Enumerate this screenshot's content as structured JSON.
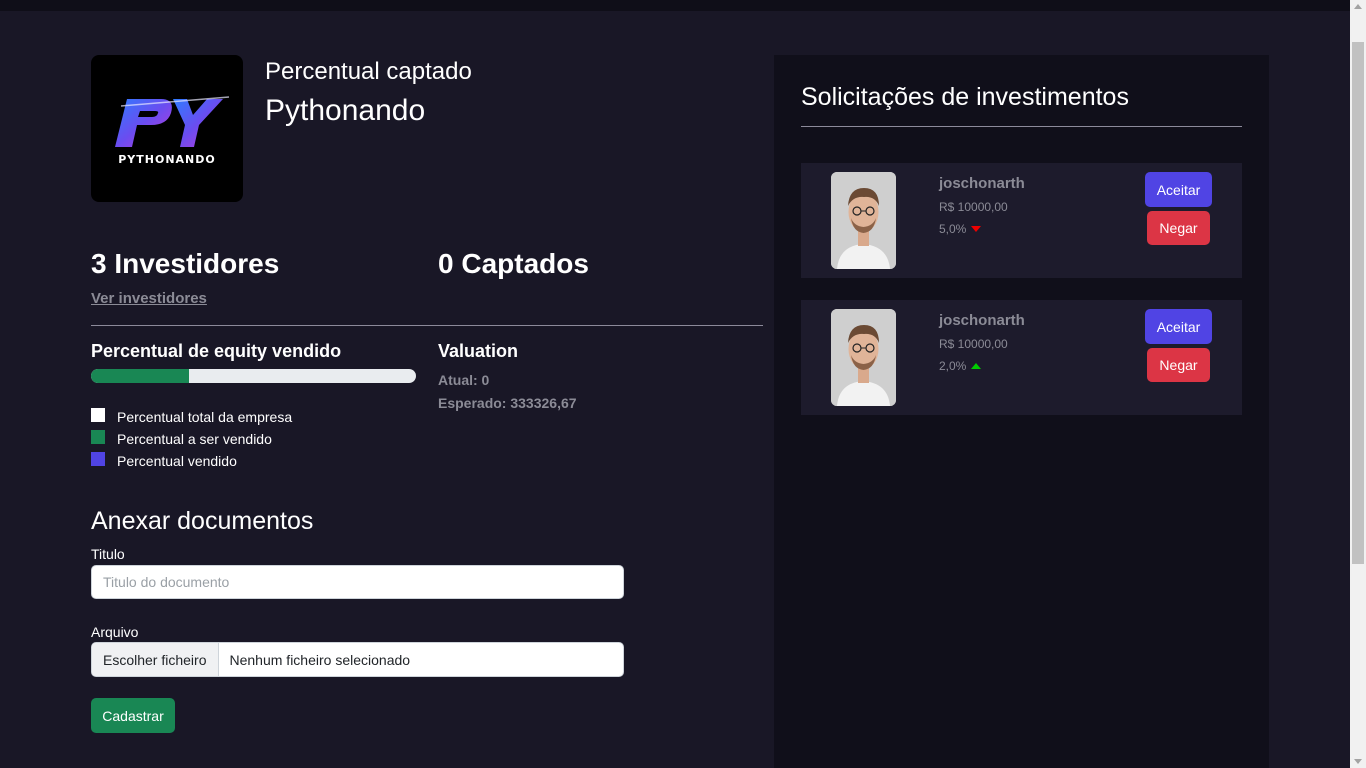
{
  "company": {
    "subtitle": "Percentual captado",
    "name": "Pythonando",
    "logo_text": "PYTHONANDO",
    "logo_monogram": "PY"
  },
  "stats": {
    "investors": "3 Investidores",
    "raised": "0 Captados",
    "view_investors_link": "Ver investidores"
  },
  "equity": {
    "title": "Percentual de equity vendido",
    "progress_fraction": 0.3,
    "progress_color": "#198754",
    "legend": [
      {
        "label": "Percentual total da empresa",
        "color": "#ffffff"
      },
      {
        "label": "Percentual a ser vendido",
        "color": "#198754"
      },
      {
        "label": "Percentual vendido",
        "color": "#5044e4"
      }
    ]
  },
  "valuation": {
    "title": "Valuation",
    "current": "Atual: 0",
    "expected": "Esperado: 333326,67"
  },
  "documents": {
    "title": "Anexar documentos",
    "title_label": "Titulo",
    "title_placeholder": "Titulo do documento",
    "file_label": "Arquivo",
    "file_button": "Escolher ficheiro",
    "file_status": "Nenhum ficheiro selecionado",
    "submit_label": "Cadastrar"
  },
  "requests": {
    "title": "Solicitações de investimentos",
    "items": [
      {
        "name": "joschonarth",
        "amount": "R$ 10000,00",
        "percent": "5,0%",
        "trend": "down",
        "accept_label": "Aceitar",
        "deny_label": "Negar"
      },
      {
        "name": "joschonarth",
        "amount": "R$ 10000,00",
        "percent": "2,0%",
        "trend": "up",
        "accept_label": "Aceitar",
        "deny_label": "Negar"
      }
    ]
  },
  "colors": {
    "background": "#191726",
    "panel": "#100f1a",
    "card": "#1d1b2c",
    "accept": "#5044e4",
    "deny": "#dc3545",
    "submit": "#198754"
  }
}
